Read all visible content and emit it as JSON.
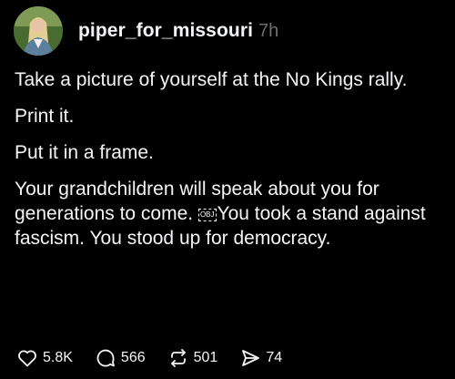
{
  "post": {
    "username": "piper_for_missouri",
    "time": "7h",
    "paragraphs": [
      "Take a picture of yourself at the No Kings rally.",
      "Print it.",
      "Put it in a frame."
    ],
    "last_paragraph": {
      "before": "Your grandchildren will speak about you for generations to come. ",
      "obj_glyph": "OBJ",
      "after": "You took a stand against fascism. You stood up for democracy."
    }
  },
  "actions": {
    "likes": "5.8K",
    "replies": "566",
    "reposts": "501",
    "shares": "74"
  },
  "colors": {
    "background": "#000000",
    "text": "#f3f5f7",
    "muted": "#6e6e6e"
  },
  "icons": {
    "like": "heart-icon",
    "reply": "comment-bubble-icon",
    "repost": "repost-icon",
    "share": "send-icon"
  }
}
